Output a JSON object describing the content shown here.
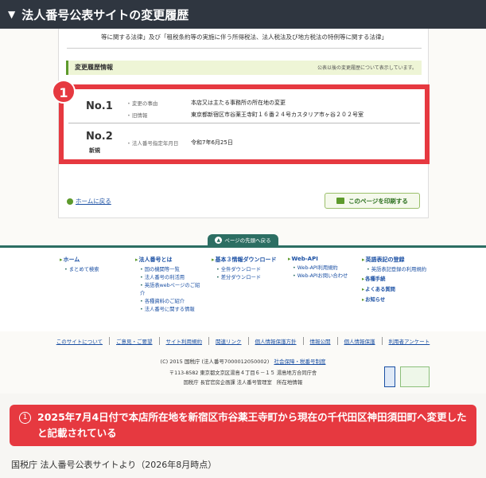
{
  "header": {
    "title": "法人番号公表サイトの変更履歴"
  },
  "card": {
    "law_text": "等に関する法律」及び「租税条約等の実施に伴う所得税法、法人税法及び地方税法の特例等に関する法律」",
    "history_title": "変更履歴情報",
    "history_note": "公表以後の変更履歴について表示しています。",
    "entries": [
      {
        "no": "No.1",
        "fields": [
          {
            "label": "変更の事由",
            "value": "本店又は主たる事務所の所在地の変更"
          },
          {
            "label": "旧情報",
            "value": "東京都新宿区市谷薬王寺町１６番２４号カスタリア市ヶ谷２０２号室"
          }
        ]
      },
      {
        "no": "No.2",
        "tag": "新規",
        "fields": [
          {
            "label": "法人番号指定年月日",
            "value": "令和7年6月25日"
          }
        ]
      }
    ],
    "badge": "1",
    "home_link": "ホームに戻る",
    "print_button": "このページを印刷する"
  },
  "page_top": "ページの先頭へ戻る",
  "sitemap": {
    "columns": [
      {
        "heading": "ホーム",
        "items": [
          "まとめて検索"
        ]
      },
      {
        "heading": "法人番号とは",
        "items": [
          "国の機関等一覧",
          "法人番号の利活用",
          "英語表webページのご紹介",
          "各種資料のご紹介",
          "法人番号に関する情報"
        ]
      },
      {
        "heading": "基本３情報ダウンロード",
        "items": [
          "全件ダウンロード",
          "差分ダウンロード"
        ]
      },
      {
        "heading": "Web-API",
        "items": [
          "Web-API利用規約",
          "Web-APIお問い合わせ"
        ]
      },
      {
        "heading": "英語表記の登録",
        "items": [
          "英語表記登録の利用規約"
        ],
        "extra": [
          "各種手続",
          "よくある質問",
          "お知らせ"
        ]
      }
    ]
  },
  "footer": {
    "links": [
      "このサイトについて",
      "ご意見・ご要望",
      "サイト利用規約",
      "関連リンク",
      "個人情報保護方針",
      "情報公開",
      "個人情報保護",
      "利用者アンケート"
    ],
    "copyright": "(C) 2015 国税庁 (法人番号7000012050002)",
    "social": "社会保障・税番号制度",
    "address1": "〒113-8582 東京都文京区湯島４丁目６－１５ 湯島地方合同庁舎",
    "address2": "国税庁 長官官房企画課 法人番号管理室",
    "map_link": "所在地情報"
  },
  "callout": {
    "number": "1",
    "text": "2025年7月4日付で本店所在地を新宿区市谷薬王寺町から現在の千代田区神田須田町へ変更したと記載されている"
  },
  "source": "国税庁 法人番号公表サイトより（2026年8月時点）",
  "colors": {
    "accent_red": "#e63940",
    "header_dark": "#2f3640",
    "teal": "#2c6e63",
    "green": "#5d9a2c",
    "link_blue": "#1a4fa3"
  }
}
